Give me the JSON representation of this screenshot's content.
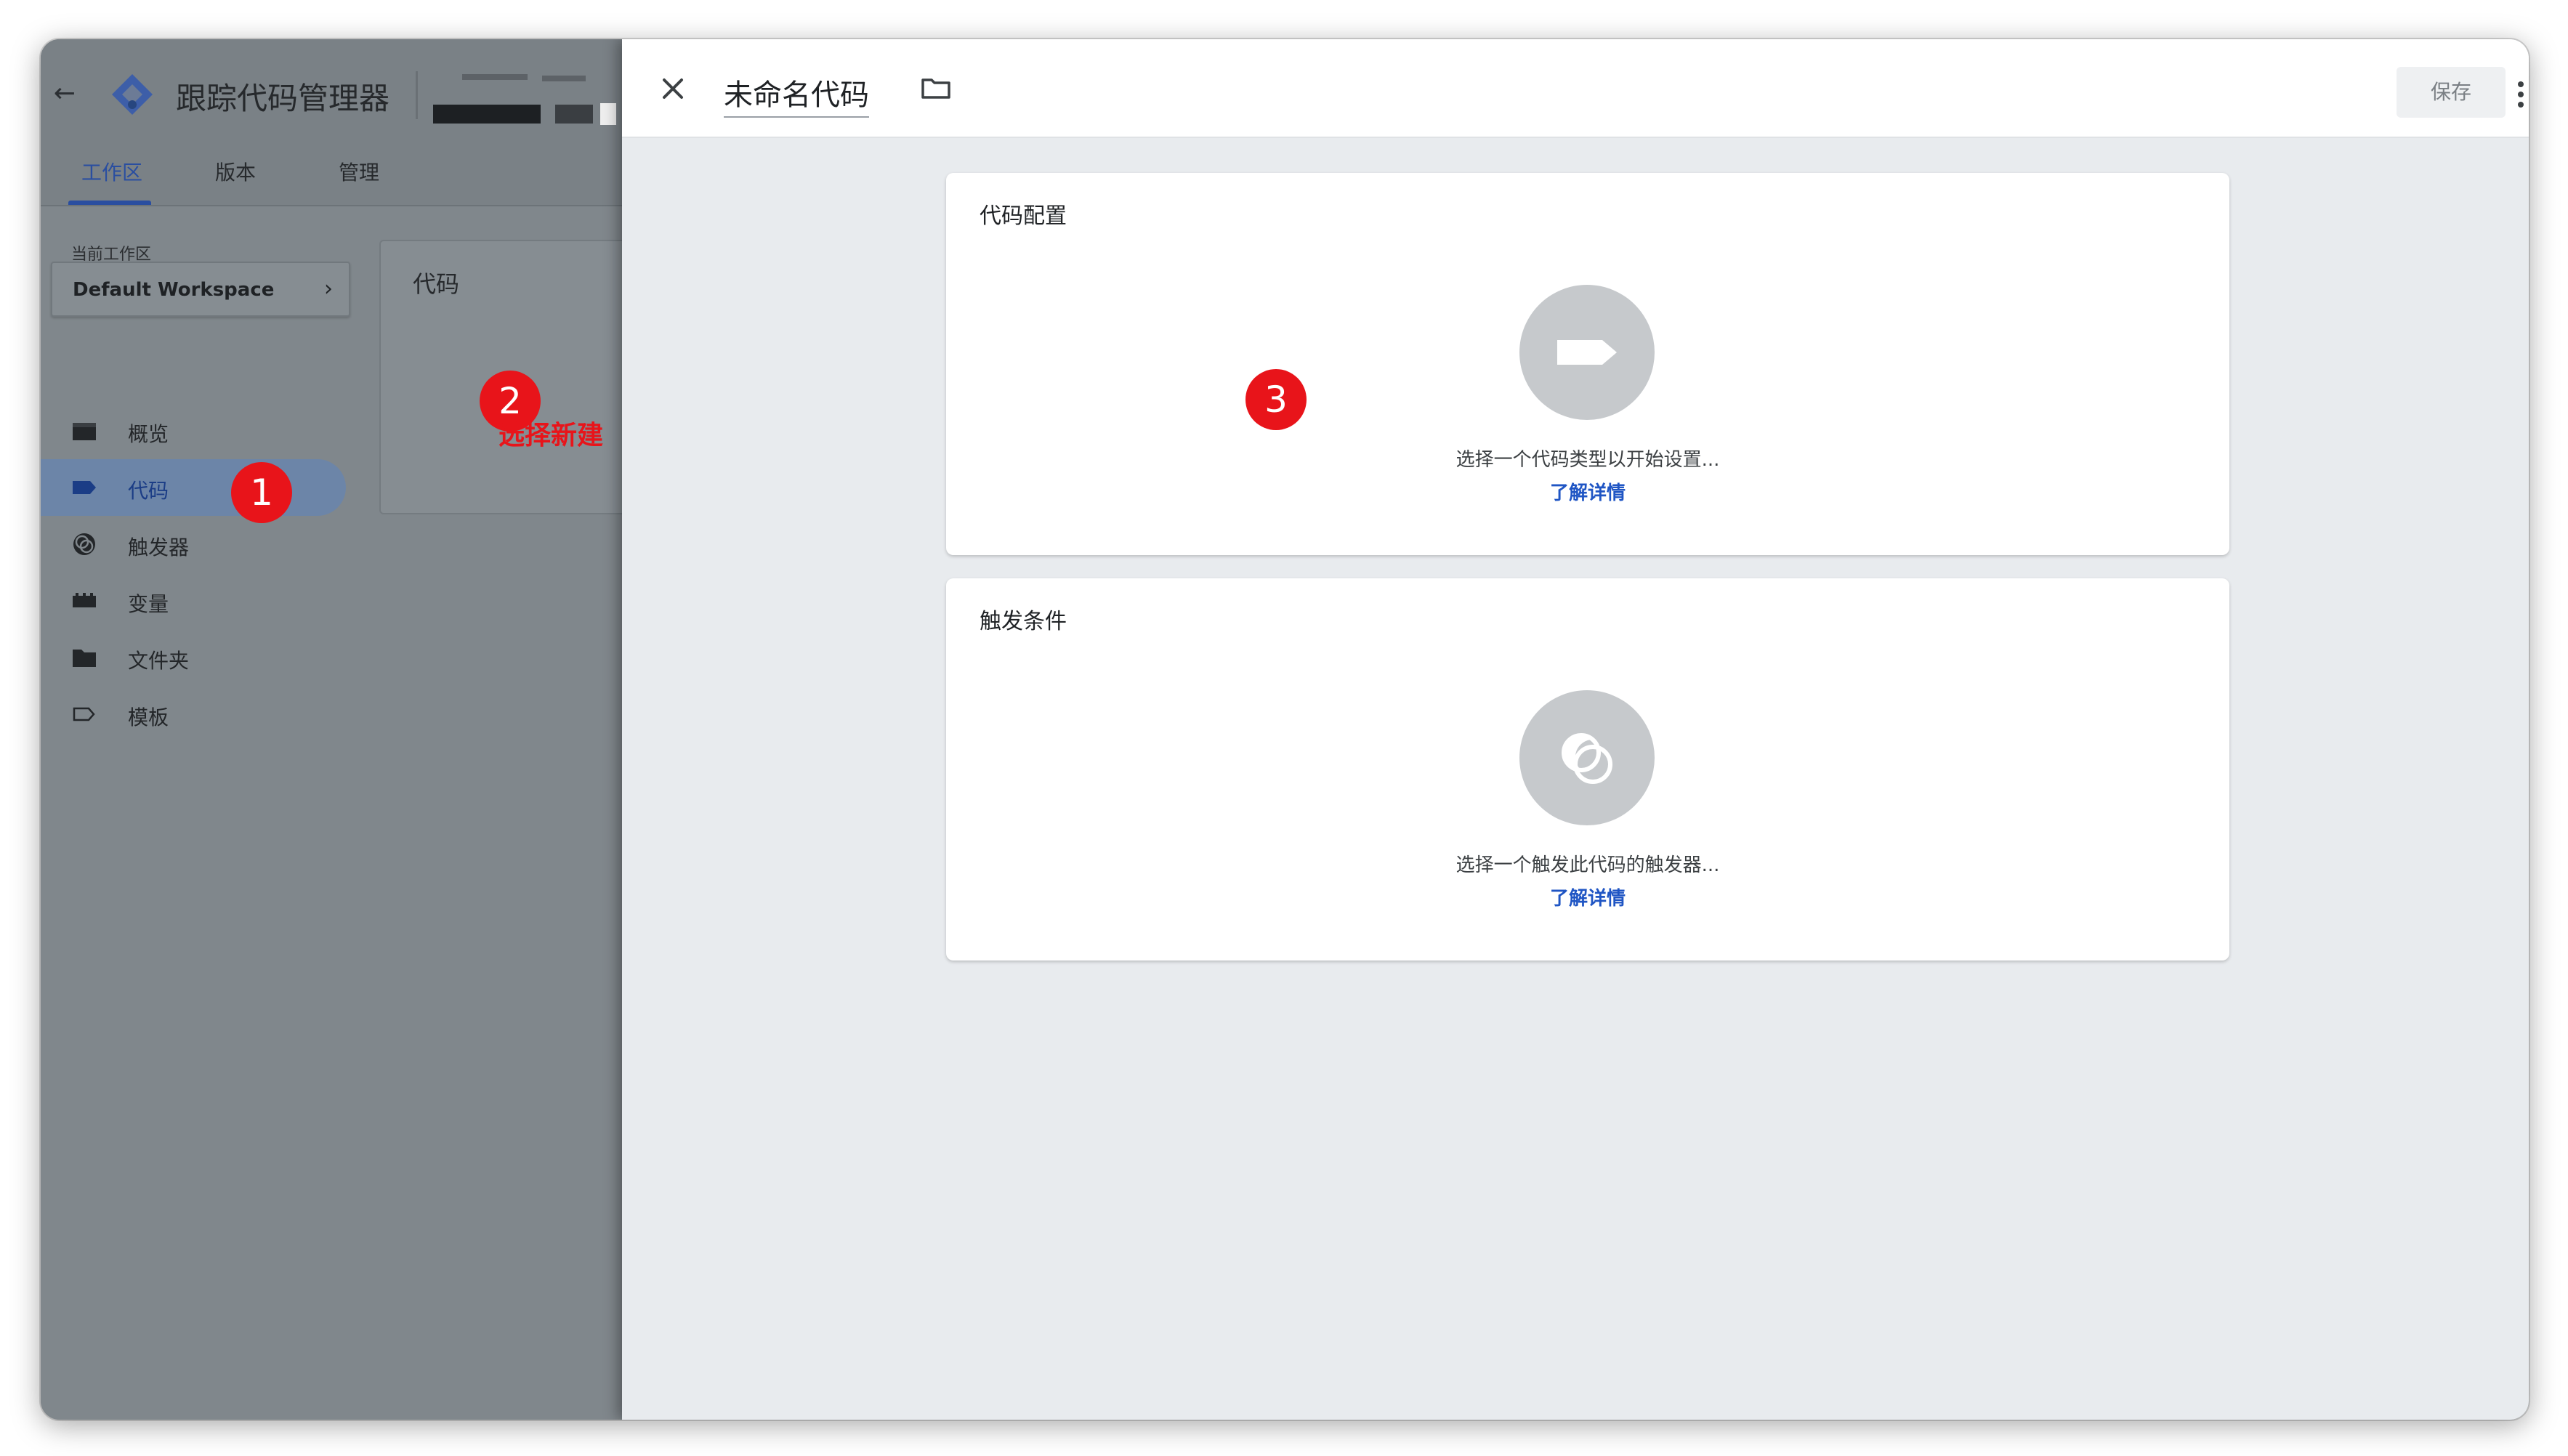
{
  "app": {
    "back_label": "←",
    "title": "跟踪代码管理器",
    "tabs": [
      {
        "label": "工作区",
        "active": true
      },
      {
        "label": "版本",
        "active": false
      },
      {
        "label": "管理",
        "active": false
      }
    ],
    "accent_color": "#2a4ea0"
  },
  "sidebar": {
    "workspace_label": "当前工作区",
    "workspace_value": "Default Workspace",
    "items": [
      {
        "label": "概览",
        "icon": "overview-icon",
        "active": false
      },
      {
        "label": "代码",
        "icon": "tag-icon",
        "active": true
      },
      {
        "label": "触发器",
        "icon": "trigger-icon",
        "active": false
      },
      {
        "label": "变量",
        "icon": "variables-icon",
        "active": false
      },
      {
        "label": "文件夹",
        "icon": "folder-icon",
        "active": false
      },
      {
        "label": "模板",
        "icon": "template-icon",
        "active": false
      }
    ]
  },
  "tags_card": {
    "title": "代码"
  },
  "annotations": {
    "marker1": "1",
    "marker2": "2",
    "marker3": "3",
    "hint": "选择新建",
    "color": "#e8141a"
  },
  "editor": {
    "tag_name": "未命名代码",
    "save_label": "保存",
    "tag_config": {
      "title": "代码配置",
      "description": "选择一个代码类型以开始设置...",
      "link": "了解详情"
    },
    "triggering": {
      "title": "触发条件",
      "description": "选择一个触发此代码的触发器...",
      "link": "了解详情"
    }
  }
}
